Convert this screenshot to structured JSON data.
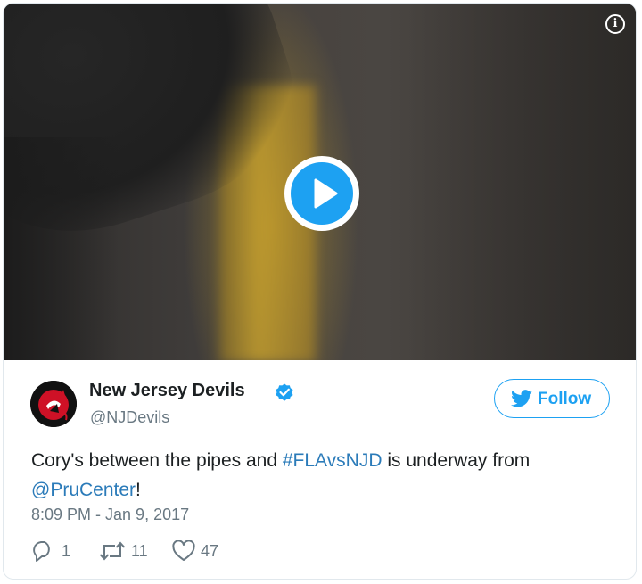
{
  "media": {
    "info_icon": "info-icon",
    "play_icon": "play-icon",
    "play_color": "#1da1f2"
  },
  "author": {
    "name": "New Jersey Devils",
    "handle": "@NJDevils",
    "verified_icon": "verified-badge-icon",
    "avatar_icon": "devils-logo"
  },
  "follow": {
    "label": "Follow",
    "icon": "twitter-bird-icon",
    "color": "#1da1f2"
  },
  "tweet": {
    "text_part1": "Cory's between the pipes and ",
    "hashtag": "#FLAvsNJD",
    "text_part2": " is underway from ",
    "mention": "@PruCenter",
    "text_part3": "!",
    "link_color": "#2b7bb9",
    "timestamp": "8:09 PM - Jan 9, 2017"
  },
  "actions": {
    "replies": "1",
    "retweets": "11",
    "likes": "47"
  }
}
